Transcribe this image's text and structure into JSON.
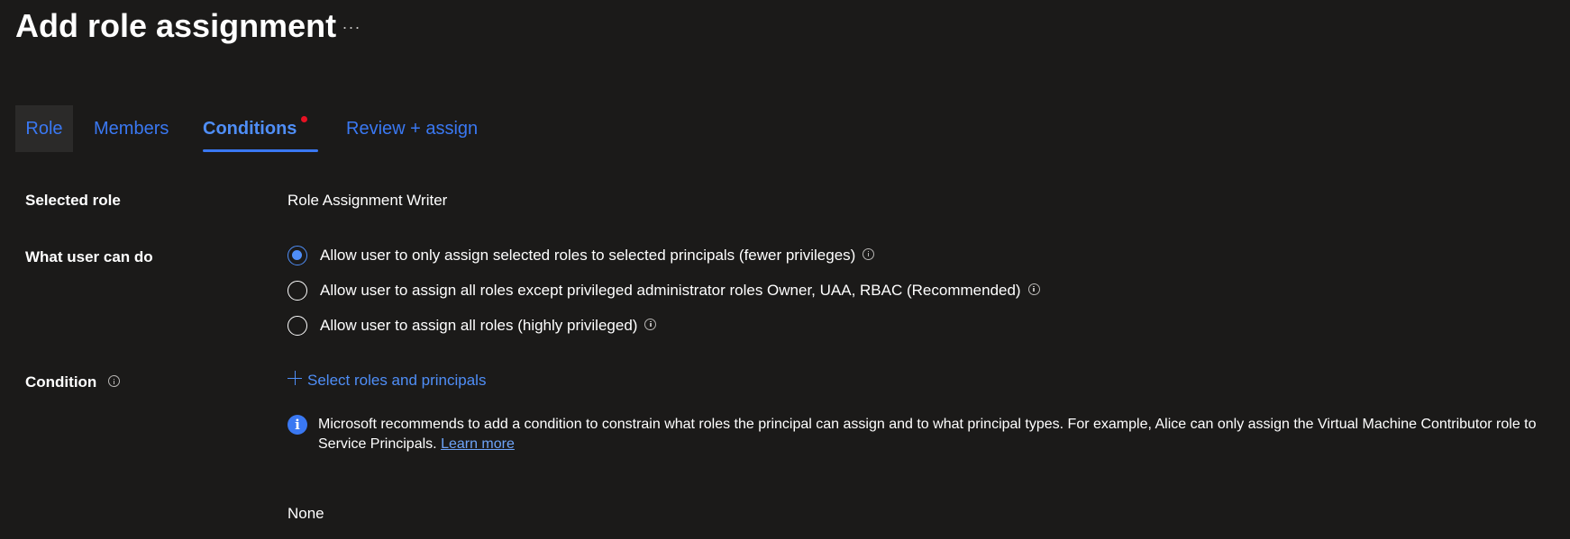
{
  "header": {
    "title": "Add role assignment",
    "more_label": "···"
  },
  "tabs": [
    {
      "label": "Role"
    },
    {
      "label": "Members"
    },
    {
      "label": "Conditions",
      "active": true,
      "has_error_dot": true
    },
    {
      "label": "Review + assign"
    }
  ],
  "form": {
    "selected_role": {
      "label": "Selected role",
      "value": "Role Assignment Writer"
    },
    "what_user_can_do": {
      "label": "What user can do",
      "options": [
        {
          "label": "Allow user to only assign selected roles to selected principals (fewer privileges)",
          "checked": true
        },
        {
          "label": "Allow user to assign all roles except privileged administrator roles Owner, UAA, RBAC (Recommended)",
          "checked": false
        },
        {
          "label": "Allow user to assign all roles (highly privileged)",
          "checked": false
        }
      ]
    },
    "condition": {
      "label": "Condition",
      "add_link": "Select roles and principals",
      "info_text": "Microsoft recommends to add a condition to constrain what roles the principal can assign and to what principal types. For example, Alice can only assign the Virtual Machine Contributor role to Service Principals.",
      "learn_more": "Learn more",
      "value": "None"
    }
  },
  "colors": {
    "background": "#1b1a19",
    "accent": "#4f8ef7",
    "error_dot": "#e81123"
  }
}
